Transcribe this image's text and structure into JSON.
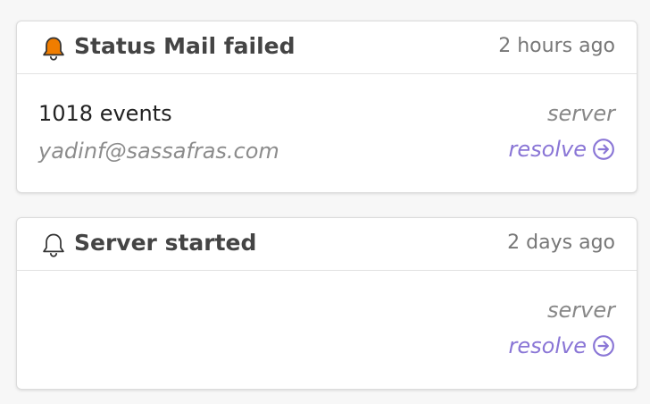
{
  "colors": {
    "bell_active": "#f07d00",
    "accent": "#8a76d6",
    "title": "#444444",
    "muted": "#888888"
  },
  "notifications": [
    {
      "icon": "bell-filled-icon",
      "title": "Status Mail failed",
      "time": "2 hours ago",
      "events": "1018 events",
      "email": "yadinf@sassafras.com",
      "source": "server",
      "action_label": "resolve",
      "action_icon": "arrow-right-circle-icon"
    },
    {
      "icon": "bell-outline-icon",
      "title": "Server started",
      "time": "2 days ago",
      "events": "",
      "email": "",
      "source": "server",
      "action_label": "resolve",
      "action_icon": "arrow-right-circle-icon"
    }
  ]
}
